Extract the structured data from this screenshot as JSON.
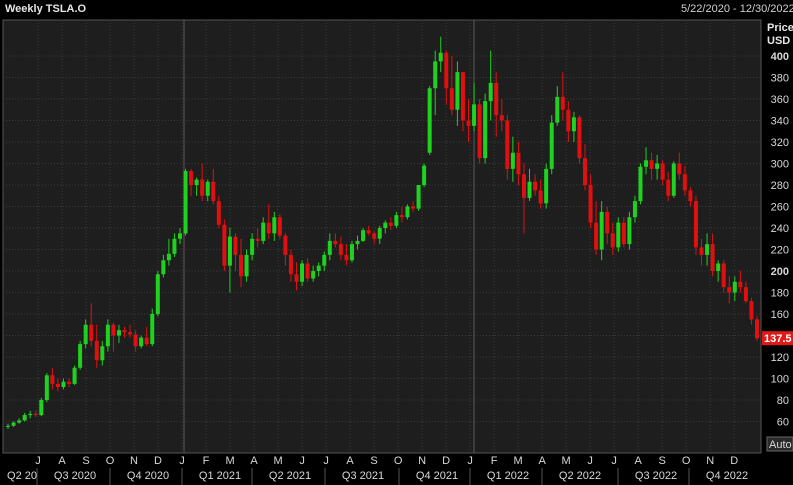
{
  "header": {
    "title": "Weekly TSLA.O",
    "date_range": "5/22/2020 - 12/30/2022"
  },
  "axis": {
    "price_label": "Price",
    "currency_label": "USD",
    "auto_button": "Auto",
    "last_price_label": "137.5"
  },
  "colors": {
    "background": "#000000",
    "plot_background": "#1e1e1e",
    "grid": "#3a3a3a",
    "up": "#1fd21f",
    "down": "#e01010",
    "axis_text": "#d8d8d8",
    "last_price_bg": "#e01818"
  },
  "chart_data": {
    "type": "candlestick",
    "title": "Weekly TSLA.O",
    "ylabel": "Price USD",
    "ylim": [
      40,
      420
    ],
    "y_ticks": [
      60,
      80,
      100,
      120,
      140,
      160,
      180,
      200,
      220,
      240,
      260,
      280,
      300,
      320,
      340,
      360,
      380,
      400
    ],
    "bold_y_ticks": [
      200,
      400
    ],
    "x_month_labels": [
      "J",
      "A",
      "S",
      "O",
      "N",
      "D",
      "J",
      "F",
      "M",
      "A",
      "M",
      "J",
      "J",
      "A",
      "S",
      "O",
      "N",
      "D",
      "J",
      "F",
      "M",
      "A",
      "M",
      "J",
      "J",
      "A",
      "S",
      "O",
      "N",
      "D"
    ],
    "x_quarter_labels": [
      "Q2 20",
      "Q3 2020",
      "Q4 2020",
      "Q1 2021",
      "Q2 2021",
      "Q3 2021",
      "Q4 2021",
      "Q1 2022",
      "Q2 2022",
      "Q3 2022",
      "Q4 2022"
    ],
    "last_close": 137.5,
    "weeks": [
      {
        "o": 55,
        "h": 58,
        "l": 53,
        "c": 56
      },
      {
        "o": 56,
        "h": 60,
        "l": 55,
        "c": 59
      },
      {
        "o": 59,
        "h": 63,
        "l": 58,
        "c": 61
      },
      {
        "o": 61,
        "h": 68,
        "l": 60,
        "c": 66
      },
      {
        "o": 66,
        "h": 70,
        "l": 63,
        "c": 67
      },
      {
        "o": 67,
        "h": 70,
        "l": 64,
        "c": 66
      },
      {
        "o": 66,
        "h": 82,
        "l": 65,
        "c": 80
      },
      {
        "o": 80,
        "h": 105,
        "l": 78,
        "c": 103
      },
      {
        "o": 103,
        "h": 110,
        "l": 90,
        "c": 95
      },
      {
        "o": 95,
        "h": 100,
        "l": 88,
        "c": 92
      },
      {
        "o": 92,
        "h": 100,
        "l": 90,
        "c": 97
      },
      {
        "o": 97,
        "h": 100,
        "l": 92,
        "c": 95
      },
      {
        "o": 95,
        "h": 112,
        "l": 94,
        "c": 110
      },
      {
        "o": 110,
        "h": 135,
        "l": 108,
        "c": 132
      },
      {
        "o": 132,
        "h": 155,
        "l": 128,
        "c": 150
      },
      {
        "o": 150,
        "h": 170,
        "l": 130,
        "c": 135
      },
      {
        "o": 135,
        "h": 150,
        "l": 110,
        "c": 117
      },
      {
        "o": 117,
        "h": 135,
        "l": 112,
        "c": 130
      },
      {
        "o": 130,
        "h": 155,
        "l": 125,
        "c": 150
      },
      {
        "o": 150,
        "h": 152,
        "l": 125,
        "c": 140
      },
      {
        "o": 140,
        "h": 150,
        "l": 133,
        "c": 145
      },
      {
        "o": 145,
        "h": 148,
        "l": 138,
        "c": 143
      },
      {
        "o": 143,
        "h": 150,
        "l": 138,
        "c": 141
      },
      {
        "o": 141,
        "h": 145,
        "l": 125,
        "c": 130
      },
      {
        "o": 130,
        "h": 140,
        "l": 128,
        "c": 138
      },
      {
        "o": 138,
        "h": 148,
        "l": 130,
        "c": 132
      },
      {
        "o": 132,
        "h": 165,
        "l": 130,
        "c": 160
      },
      {
        "o": 160,
        "h": 200,
        "l": 158,
        "c": 197
      },
      {
        "o": 197,
        "h": 215,
        "l": 194,
        "c": 210
      },
      {
        "o": 210,
        "h": 230,
        "l": 205,
        "c": 216
      },
      {
        "o": 216,
        "h": 235,
        "l": 213,
        "c": 230
      },
      {
        "o": 230,
        "h": 240,
        "l": 225,
        "c": 235
      },
      {
        "o": 235,
        "h": 295,
        "l": 233,
        "c": 293
      },
      {
        "o": 293,
        "h": 295,
        "l": 270,
        "c": 280
      },
      {
        "o": 280,
        "h": 287,
        "l": 270,
        "c": 285
      },
      {
        "o": 285,
        "h": 300,
        "l": 265,
        "c": 270
      },
      {
        "o": 270,
        "h": 285,
        "l": 265,
        "c": 283
      },
      {
        "o": 283,
        "h": 295,
        "l": 262,
        "c": 265
      },
      {
        "o": 265,
        "h": 270,
        "l": 240,
        "c": 243
      },
      {
        "o": 243,
        "h": 248,
        "l": 200,
        "c": 205
      },
      {
        "o": 205,
        "h": 240,
        "l": 180,
        "c": 232
      },
      {
        "o": 232,
        "h": 235,
        "l": 200,
        "c": 215
      },
      {
        "o": 215,
        "h": 230,
        "l": 185,
        "c": 195
      },
      {
        "o": 195,
        "h": 220,
        "l": 190,
        "c": 215
      },
      {
        "o": 215,
        "h": 235,
        "l": 210,
        "c": 230
      },
      {
        "o": 230,
        "h": 240,
        "l": 222,
        "c": 228
      },
      {
        "o": 228,
        "h": 250,
        "l": 225,
        "c": 245
      },
      {
        "o": 245,
        "h": 262,
        "l": 230,
        "c": 235
      },
      {
        "o": 235,
        "h": 255,
        "l": 228,
        "c": 250
      },
      {
        "o": 250,
        "h": 253,
        "l": 230,
        "c": 233
      },
      {
        "o": 233,
        "h": 235,
        "l": 205,
        "c": 215
      },
      {
        "o": 215,
        "h": 220,
        "l": 190,
        "c": 197
      },
      {
        "o": 197,
        "h": 208,
        "l": 182,
        "c": 190
      },
      {
        "o": 190,
        "h": 210,
        "l": 186,
        "c": 207
      },
      {
        "o": 207,
        "h": 212,
        "l": 190,
        "c": 193
      },
      {
        "o": 193,
        "h": 205,
        "l": 190,
        "c": 200
      },
      {
        "o": 200,
        "h": 208,
        "l": 195,
        "c": 205
      },
      {
        "o": 205,
        "h": 218,
        "l": 200,
        "c": 215
      },
      {
        "o": 215,
        "h": 235,
        "l": 210,
        "c": 228
      },
      {
        "o": 228,
        "h": 235,
        "l": 222,
        "c": 225
      },
      {
        "o": 225,
        "h": 232,
        "l": 210,
        "c": 215
      },
      {
        "o": 215,
        "h": 225,
        "l": 205,
        "c": 210
      },
      {
        "o": 210,
        "h": 228,
        "l": 208,
        "c": 225
      },
      {
        "o": 225,
        "h": 233,
        "l": 220,
        "c": 228
      },
      {
        "o": 228,
        "h": 240,
        "l": 227,
        "c": 238
      },
      {
        "o": 238,
        "h": 242,
        "l": 233,
        "c": 235
      },
      {
        "o": 235,
        "h": 237,
        "l": 225,
        "c": 230
      },
      {
        "o": 230,
        "h": 242,
        "l": 225,
        "c": 240
      },
      {
        "o": 240,
        "h": 247,
        "l": 235,
        "c": 245
      },
      {
        "o": 245,
        "h": 250,
        "l": 238,
        "c": 242
      },
      {
        "o": 242,
        "h": 255,
        "l": 240,
        "c": 252
      },
      {
        "o": 252,
        "h": 260,
        "l": 245,
        "c": 250
      },
      {
        "o": 250,
        "h": 262,
        "l": 248,
        "c": 260
      },
      {
        "o": 260,
        "h": 265,
        "l": 255,
        "c": 258
      },
      {
        "o": 258,
        "h": 275,
        "l": 256,
        "c": 280
      },
      {
        "o": 280,
        "h": 300,
        "l": 278,
        "c": 298
      },
      {
        "o": 310,
        "h": 372,
        "l": 308,
        "c": 370
      },
      {
        "o": 370,
        "h": 405,
        "l": 345,
        "c": 395
      },
      {
        "o": 395,
        "h": 418,
        "l": 385,
        "c": 403
      },
      {
        "o": 403,
        "h": 405,
        "l": 355,
        "c": 370
      },
      {
        "o": 370,
        "h": 400,
        "l": 345,
        "c": 350
      },
      {
        "o": 350,
        "h": 395,
        "l": 335,
        "c": 385
      },
      {
        "o": 385,
        "h": 385,
        "l": 330,
        "c": 340
      },
      {
        "o": 340,
        "h": 360,
        "l": 320,
        "c": 335
      },
      {
        "o": 335,
        "h": 375,
        "l": 330,
        "c": 355
      },
      {
        "o": 355,
        "h": 360,
        "l": 300,
        "c": 305
      },
      {
        "o": 305,
        "h": 365,
        "l": 300,
        "c": 358
      },
      {
        "o": 358,
        "h": 405,
        "l": 340,
        "c": 375
      },
      {
        "o": 375,
        "h": 385,
        "l": 325,
        "c": 345
      },
      {
        "o": 345,
        "h": 360,
        "l": 330,
        "c": 340
      },
      {
        "o": 340,
        "h": 345,
        "l": 285,
        "c": 295
      },
      {
        "o": 295,
        "h": 325,
        "l": 283,
        "c": 310
      },
      {
        "o": 310,
        "h": 320,
        "l": 280,
        "c": 290
      },
      {
        "o": 290,
        "h": 300,
        "l": 235,
        "c": 268
      },
      {
        "o": 268,
        "h": 295,
        "l": 265,
        "c": 283
      },
      {
        "o": 283,
        "h": 290,
        "l": 270,
        "c": 275
      },
      {
        "o": 275,
        "h": 285,
        "l": 258,
        "c": 263
      },
      {
        "o": 263,
        "h": 300,
        "l": 258,
        "c": 295
      },
      {
        "o": 295,
        "h": 345,
        "l": 290,
        "c": 338
      },
      {
        "o": 338,
        "h": 372,
        "l": 335,
        "c": 362
      },
      {
        "o": 362,
        "h": 385,
        "l": 340,
        "c": 350
      },
      {
        "o": 350,
        "h": 358,
        "l": 320,
        "c": 330
      },
      {
        "o": 330,
        "h": 348,
        "l": 320,
        "c": 343
      },
      {
        "o": 343,
        "h": 345,
        "l": 300,
        "c": 305
      },
      {
        "o": 305,
        "h": 318,
        "l": 275,
        "c": 280
      },
      {
        "o": 280,
        "h": 290,
        "l": 240,
        "c": 245
      },
      {
        "o": 245,
        "h": 265,
        "l": 215,
        "c": 220
      },
      {
        "o": 220,
        "h": 265,
        "l": 210,
        "c": 255
      },
      {
        "o": 255,
        "h": 260,
        "l": 225,
        "c": 235
      },
      {
        "o": 235,
        "h": 245,
        "l": 215,
        "c": 222
      },
      {
        "o": 222,
        "h": 250,
        "l": 218,
        "c": 245
      },
      {
        "o": 245,
        "h": 250,
        "l": 222,
        "c": 225
      },
      {
        "o": 225,
        "h": 255,
        "l": 220,
        "c": 250
      },
      {
        "o": 250,
        "h": 270,
        "l": 245,
        "c": 265
      },
      {
        "o": 265,
        "h": 300,
        "l": 262,
        "c": 297
      },
      {
        "o": 297,
        "h": 315,
        "l": 290,
        "c": 303
      },
      {
        "o": 303,
        "h": 310,
        "l": 285,
        "c": 295
      },
      {
        "o": 295,
        "h": 308,
        "l": 285,
        "c": 300
      },
      {
        "o": 300,
        "h": 303,
        "l": 280,
        "c": 285
      },
      {
        "o": 285,
        "h": 292,
        "l": 265,
        "c": 270
      },
      {
        "o": 270,
        "h": 302,
        "l": 268,
        "c": 300
      },
      {
        "o": 300,
        "h": 310,
        "l": 285,
        "c": 290
      },
      {
        "o": 290,
        "h": 298,
        "l": 270,
        "c": 275
      },
      {
        "o": 275,
        "h": 278,
        "l": 260,
        "c": 265
      },
      {
        "o": 265,
        "h": 270,
        "l": 215,
        "c": 222
      },
      {
        "o": 222,
        "h": 230,
        "l": 205,
        "c": 215
      },
      {
        "o": 215,
        "h": 235,
        "l": 205,
        "c": 225
      },
      {
        "o": 225,
        "h": 235,
        "l": 195,
        "c": 200
      },
      {
        "o": 200,
        "h": 210,
        "l": 190,
        "c": 207
      },
      {
        "o": 207,
        "h": 210,
        "l": 180,
        "c": 185
      },
      {
        "o": 185,
        "h": 195,
        "l": 170,
        "c": 180
      },
      {
        "o": 180,
        "h": 195,
        "l": 172,
        "c": 190
      },
      {
        "o": 190,
        "h": 200,
        "l": 180,
        "c": 185
      },
      {
        "o": 185,
        "h": 190,
        "l": 170,
        "c": 172
      },
      {
        "o": 172,
        "h": 175,
        "l": 150,
        "c": 155
      },
      {
        "o": 155,
        "h": 158,
        "l": 135,
        "c": 137.5
      }
    ]
  }
}
